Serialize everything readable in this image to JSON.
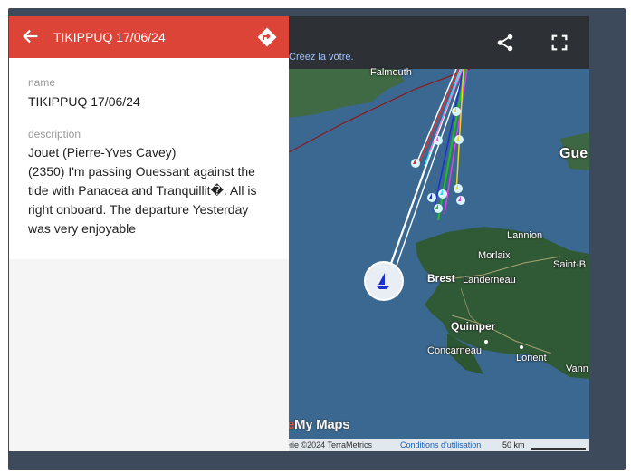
{
  "panel": {
    "title": "TIKIPPUQ 17/06/24",
    "name_label": "name",
    "name_value": "TIKIPPUQ 17/06/24",
    "description_label": "description",
    "description_lines": [
      "Jouet (Pierre-Yves Cavey)",
      "(2350) I'm passing Ouessant against the",
      "tide with Panacea and Tranquillit�. All is",
      "right onboard. The departure Yesterday",
      "was very enjoyable"
    ]
  },
  "map": {
    "create_link": "Créez la vôtre.",
    "places": {
      "falmouth": "Falmouth",
      "guernsey": "Gue",
      "lannion": "Lannion",
      "morlaix": "Morlaix",
      "saint_brieuc": "Saint-B",
      "brest": "Brest",
      "landerneau": "Landerneau",
      "quimper": "Quimper",
      "concarneau": "Concarneau",
      "lorient": "Lorient",
      "vannes": "Vann"
    },
    "watermark_accent": "e",
    "watermark_text": "My Maps",
    "attribution": "erie ©2024 TerraMetrics",
    "terms": "Conditions d'utilisation",
    "scale": "50 km"
  },
  "icons": {
    "back": "arrow-left-icon",
    "directions": "directions-icon",
    "share": "share-icon",
    "fullscreen": "fullscreen-icon",
    "boat": "sailboat-icon"
  },
  "colors": {
    "header": "#db4437",
    "map_bar": "#2d3034",
    "sea": "#3b6a92",
    "land": "#2f5a35",
    "frame": "#3c4a5c"
  }
}
